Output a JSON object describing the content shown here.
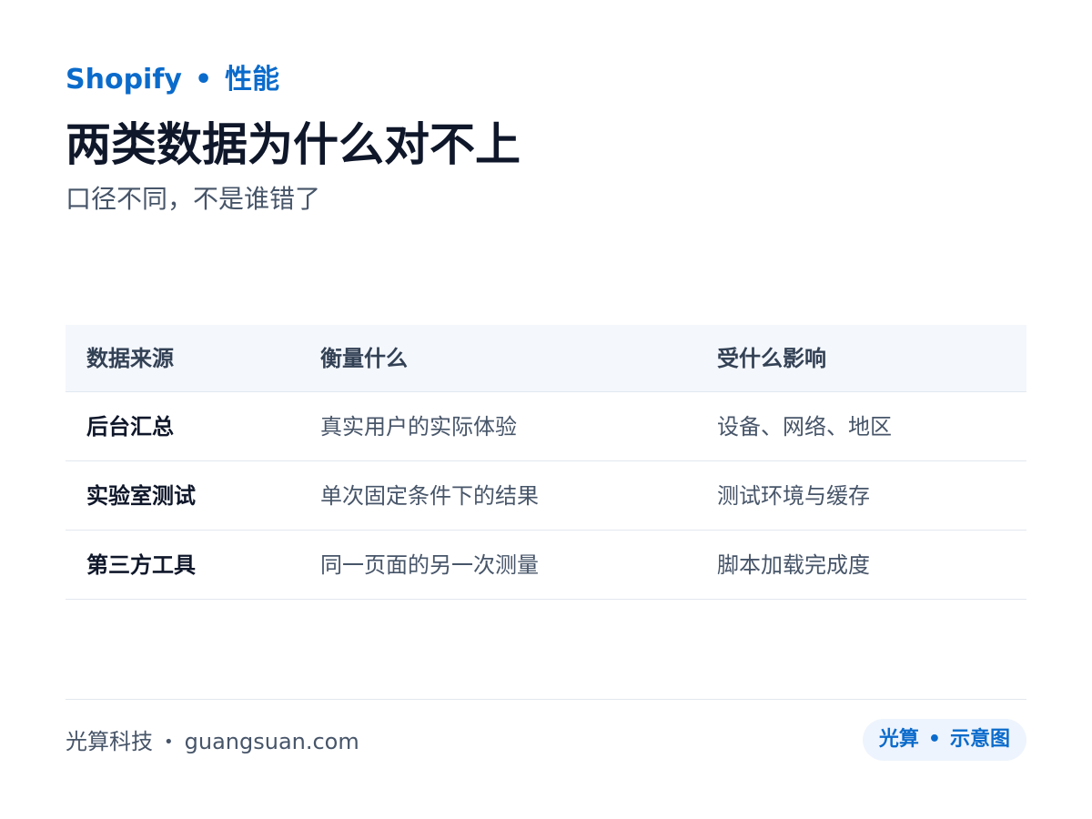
{
  "header": {
    "brand": "Shopify",
    "separator": "•",
    "section": "性能",
    "title": "两类数据为什么对不上",
    "subtitle": "口径不同，不是谁错了"
  },
  "table": {
    "columns": [
      "数据来源",
      "衡量什么",
      "受什么影响"
    ],
    "rows": [
      [
        "后台汇总",
        "真实用户的实际体验",
        "设备、网络、地区"
      ],
      [
        "实验室测试",
        "单次固定条件下的结果",
        "测试环境与缓存"
      ],
      [
        "第三方工具",
        "同一页面的另一次测量",
        "脚本加载完成度"
      ]
    ]
  },
  "footer": {
    "company": "光算科技",
    "separator": "•",
    "website": "guangsuan.com",
    "badge_left": "光算",
    "badge_separator": "•",
    "badge_right": "示意图"
  },
  "colors": {
    "accent": "#0b6bcb",
    "title": "#0f172a",
    "muted": "#475569",
    "header_bg": "#f4f7fc",
    "rule": "#e2e8f0",
    "badge_bg": "#eef4fd"
  }
}
